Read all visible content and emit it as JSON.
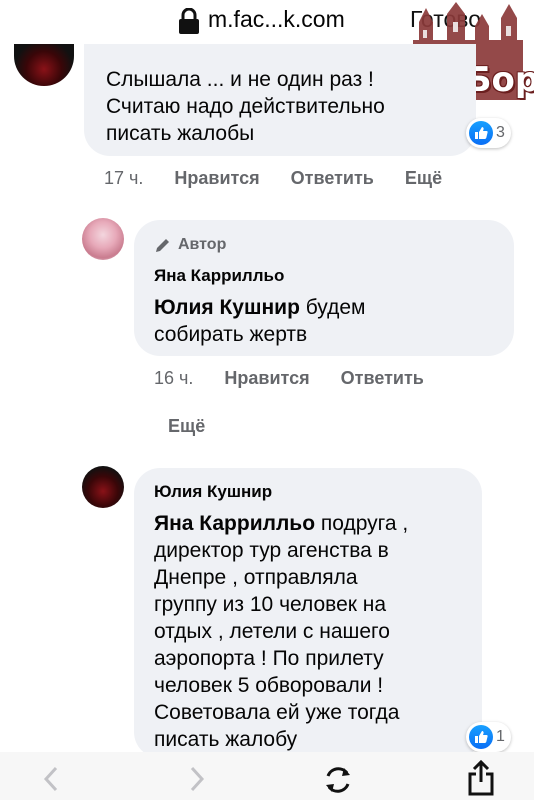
{
  "browser": {
    "url": "m.fac...k.com",
    "done_label": "Готово"
  },
  "watermark": {
    "text": "ZаБор"
  },
  "comments": [
    {
      "text": "Слышала ... и не один раз ! Считаю надо действительно писать жалобы",
      "line1": "Слышала ... и не один раз !",
      "line2": "Считаю надо действительно",
      "line3": "писать жалобы",
      "reactions": "3",
      "time": "17 ч.",
      "like": "Нравится",
      "reply": "Ответить",
      "more": "Ещё"
    },
    {
      "author_badge": "Автор",
      "author": "Яна Каррилльо",
      "mention": "Юлия Кушнир",
      "line1_rest": " будем",
      "line2": "собирать жертв",
      "time": "16 ч.",
      "like": "Нравится",
      "reply": "Ответить",
      "more": "Ещё"
    },
    {
      "author": "Юлия Кушнир",
      "mention": "Яна Каррилльо",
      "line1_rest": " подруга ,",
      "lines": [
        "директор тур агенства в",
        "Днепре , отправляла",
        "группу из 10 человек на",
        "отдых , летели с нашего",
        "аэропорта ! По прилету",
        "человек 5 обворовали !",
        "Советовала ей уже тогда",
        "писать жалобу"
      ],
      "reactions": "1"
    }
  ],
  "colors": {
    "bubble": "#eff1f5",
    "secondary_text": "#65676b",
    "like_blue": "#0a6ef5"
  },
  "icons": [
    "lock-icon",
    "pencil-icon",
    "like-icon",
    "back-icon",
    "forward-icon",
    "reload-icon",
    "share-icon"
  ]
}
